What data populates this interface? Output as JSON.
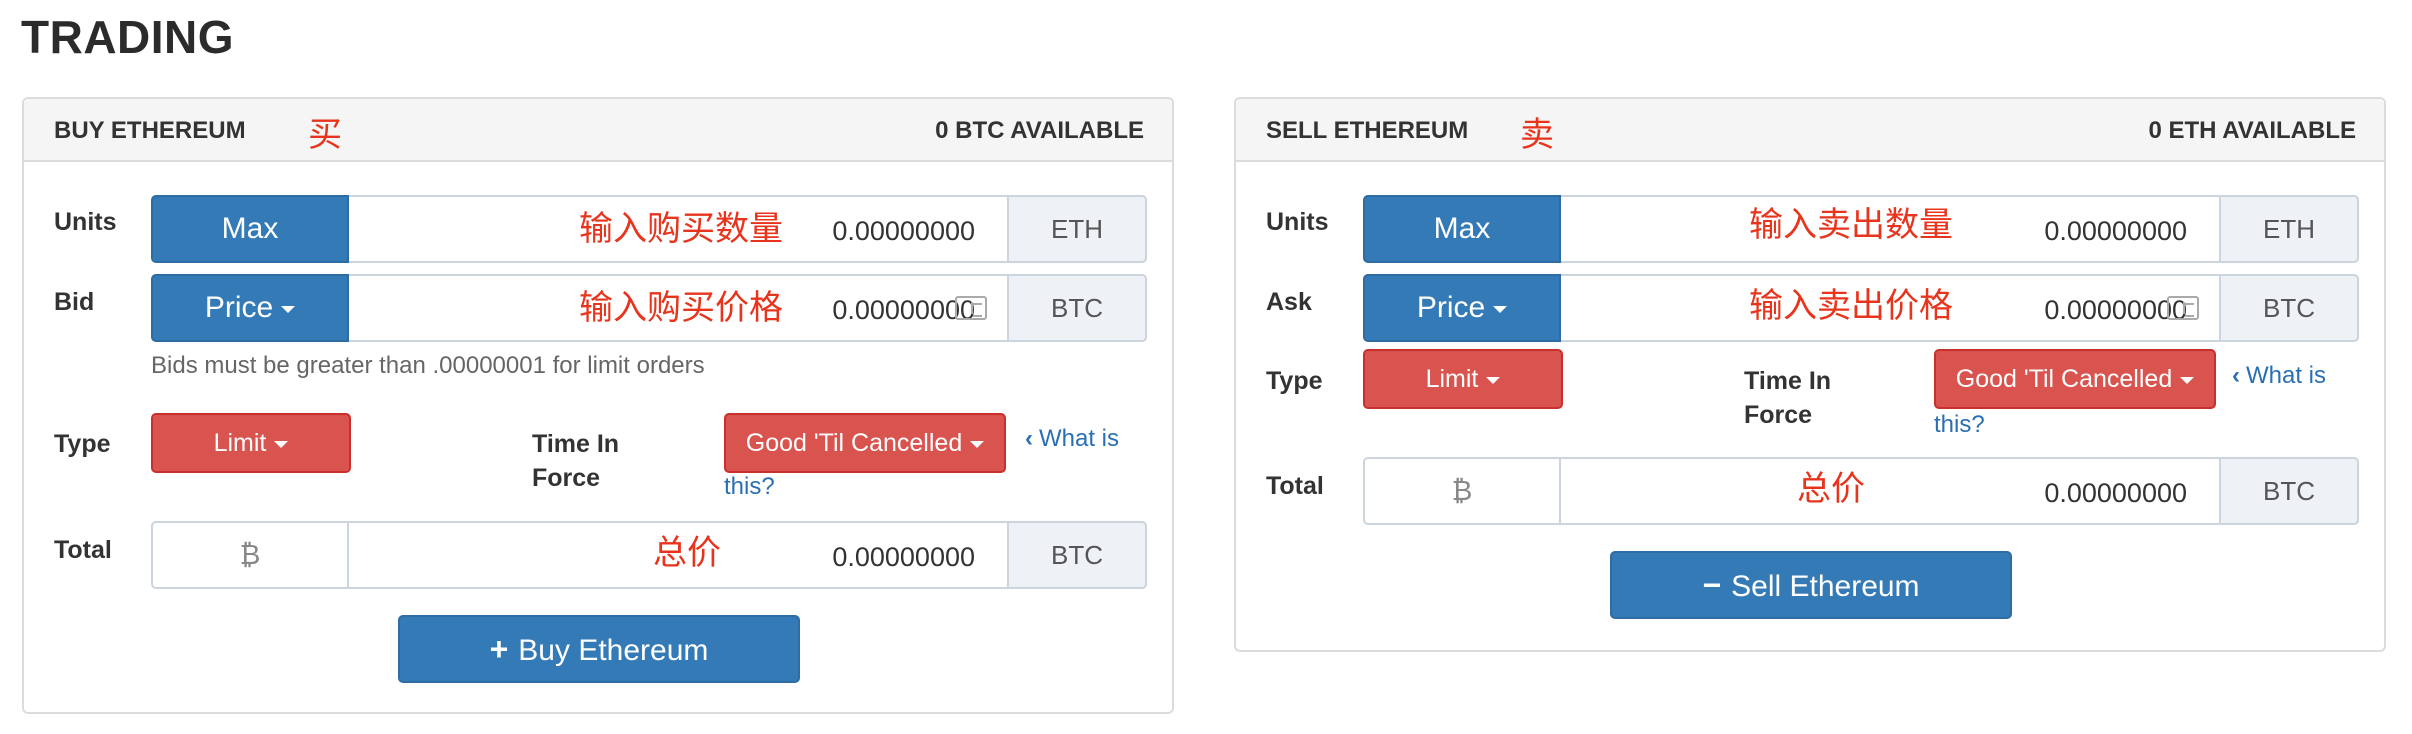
{
  "page": {
    "title": "TRADING"
  },
  "buy": {
    "header": "BUY ETHEREUM",
    "header_note": "买",
    "available": "0 BTC AVAILABLE",
    "units_label": "Units",
    "max_label": "Max",
    "units_note": "输入购买数量",
    "units_value": "0.00000000",
    "units_currency": "ETH",
    "bid_label": "Bid",
    "price_label": "Price",
    "price_note": "输入购买价格",
    "price_value": "0.00000000",
    "price_currency": "BTC",
    "help": "Bids must be greater than .00000001 for limit orders",
    "type_label": "Type",
    "type_value": "Limit",
    "tif_label_1": "Time In",
    "tif_label_2": "Force",
    "tif_value": "Good 'Til Cancelled",
    "what_is_1": "What is",
    "what_is_2": "this?",
    "total_label": "Total",
    "total_symbol": "₿",
    "total_note": "总价",
    "total_value": "0.00000000",
    "total_currency": "BTC",
    "action_symbol": "+",
    "action_label": "Buy Ethereum"
  },
  "sell": {
    "header": "SELL ETHEREUM",
    "header_note": "卖",
    "available": "0 ETH AVAILABLE",
    "units_label": "Units",
    "max_label": "Max",
    "units_note": "输入卖出数量",
    "units_value": "0.00000000",
    "units_currency": "ETH",
    "ask_label": "Ask",
    "price_label": "Price",
    "price_note": "输入卖出价格",
    "price_value": "0.00000000",
    "price_currency": "BTC",
    "type_label": "Type",
    "type_value": "Limit",
    "tif_label_1": "Time In",
    "tif_label_2": "Force",
    "tif_value": "Good 'Til Cancelled",
    "what_is_1": "What is",
    "what_is_2": "this?",
    "total_label": "Total",
    "total_symbol": "₿",
    "total_note": "总价",
    "total_value": "0.00000000",
    "total_currency": "BTC",
    "action_symbol": "−",
    "action_label": "Sell Ethereum"
  },
  "colors": {
    "primary": "#337ab7",
    "danger": "#d9534f",
    "annotation": "#e8341c",
    "link": "#2a6fb3"
  },
  "icons": {
    "calculator": "calculator-icon",
    "bitcoin": "bitcoin-icon",
    "caret": "caret-down-icon",
    "chevron": "chevron-left-icon"
  }
}
